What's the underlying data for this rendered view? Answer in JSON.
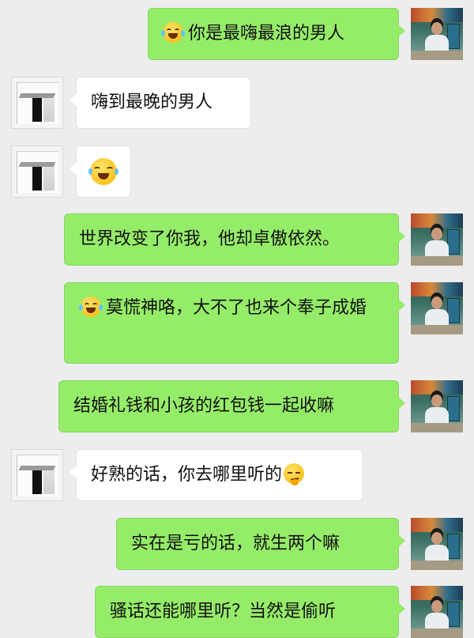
{
  "messages": [
    {
      "side": "me",
      "emoji_before": "laughing-crying",
      "text": "你是最嗨最浪的男人"
    },
    {
      "side": "them",
      "text": "嗨到最晚的男人"
    },
    {
      "side": "them",
      "emoji_only": "facepalm-laughing"
    },
    {
      "side": "me",
      "text": "世界改变了你我，他却卓傲依然。"
    },
    {
      "side": "me",
      "emoji_before": "laughing-crying",
      "text": "莫慌神咯，大不了也来个奉子成婚"
    },
    {
      "side": "me",
      "text": "结婚礼钱和小孩的红包钱一起收嘛"
    },
    {
      "side": "them",
      "text": "好熟的话，你去哪里听的",
      "emoji_after": "thinking-smirk"
    },
    {
      "side": "me",
      "text": "实在是亏的话，就生两个嘛"
    },
    {
      "side": "me",
      "text": "骚话还能哪里听？当然是偷听"
    }
  ],
  "colors": {
    "background": "#ededed",
    "my_bubble": "#95ec69",
    "their_bubble": "#ffffff"
  }
}
